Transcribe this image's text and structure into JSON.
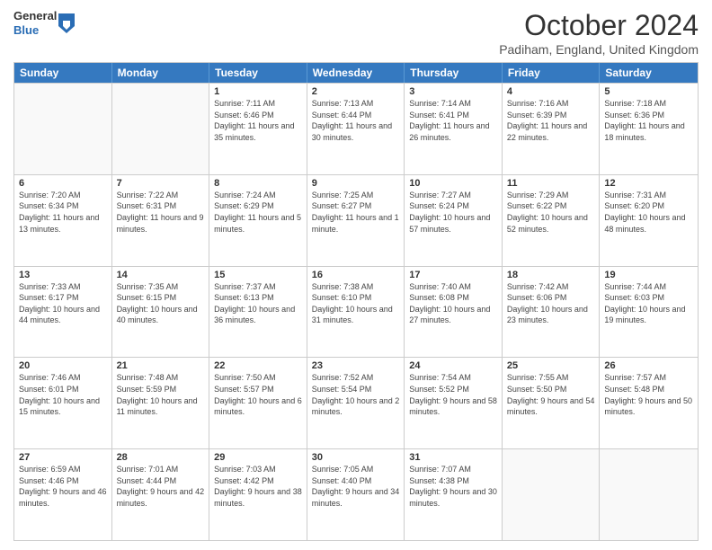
{
  "header": {
    "logo_general": "General",
    "logo_blue": "Blue",
    "month_title": "October 2024",
    "location": "Padiham, England, United Kingdom"
  },
  "day_headers": [
    "Sunday",
    "Monday",
    "Tuesday",
    "Wednesday",
    "Thursday",
    "Friday",
    "Saturday"
  ],
  "weeks": [
    [
      {
        "day": "",
        "sunrise": "",
        "sunset": "",
        "daylight": ""
      },
      {
        "day": "",
        "sunrise": "",
        "sunset": "",
        "daylight": ""
      },
      {
        "day": "1",
        "sunrise": "Sunrise: 7:11 AM",
        "sunset": "Sunset: 6:46 PM",
        "daylight": "Daylight: 11 hours and 35 minutes."
      },
      {
        "day": "2",
        "sunrise": "Sunrise: 7:13 AM",
        "sunset": "Sunset: 6:44 PM",
        "daylight": "Daylight: 11 hours and 30 minutes."
      },
      {
        "day": "3",
        "sunrise": "Sunrise: 7:14 AM",
        "sunset": "Sunset: 6:41 PM",
        "daylight": "Daylight: 11 hours and 26 minutes."
      },
      {
        "day": "4",
        "sunrise": "Sunrise: 7:16 AM",
        "sunset": "Sunset: 6:39 PM",
        "daylight": "Daylight: 11 hours and 22 minutes."
      },
      {
        "day": "5",
        "sunrise": "Sunrise: 7:18 AM",
        "sunset": "Sunset: 6:36 PM",
        "daylight": "Daylight: 11 hours and 18 minutes."
      }
    ],
    [
      {
        "day": "6",
        "sunrise": "Sunrise: 7:20 AM",
        "sunset": "Sunset: 6:34 PM",
        "daylight": "Daylight: 11 hours and 13 minutes."
      },
      {
        "day": "7",
        "sunrise": "Sunrise: 7:22 AM",
        "sunset": "Sunset: 6:31 PM",
        "daylight": "Daylight: 11 hours and 9 minutes."
      },
      {
        "day": "8",
        "sunrise": "Sunrise: 7:24 AM",
        "sunset": "Sunset: 6:29 PM",
        "daylight": "Daylight: 11 hours and 5 minutes."
      },
      {
        "day": "9",
        "sunrise": "Sunrise: 7:25 AM",
        "sunset": "Sunset: 6:27 PM",
        "daylight": "Daylight: 11 hours and 1 minute."
      },
      {
        "day": "10",
        "sunrise": "Sunrise: 7:27 AM",
        "sunset": "Sunset: 6:24 PM",
        "daylight": "Daylight: 10 hours and 57 minutes."
      },
      {
        "day": "11",
        "sunrise": "Sunrise: 7:29 AM",
        "sunset": "Sunset: 6:22 PM",
        "daylight": "Daylight: 10 hours and 52 minutes."
      },
      {
        "day": "12",
        "sunrise": "Sunrise: 7:31 AM",
        "sunset": "Sunset: 6:20 PM",
        "daylight": "Daylight: 10 hours and 48 minutes."
      }
    ],
    [
      {
        "day": "13",
        "sunrise": "Sunrise: 7:33 AM",
        "sunset": "Sunset: 6:17 PM",
        "daylight": "Daylight: 10 hours and 44 minutes."
      },
      {
        "day": "14",
        "sunrise": "Sunrise: 7:35 AM",
        "sunset": "Sunset: 6:15 PM",
        "daylight": "Daylight: 10 hours and 40 minutes."
      },
      {
        "day": "15",
        "sunrise": "Sunrise: 7:37 AM",
        "sunset": "Sunset: 6:13 PM",
        "daylight": "Daylight: 10 hours and 36 minutes."
      },
      {
        "day": "16",
        "sunrise": "Sunrise: 7:38 AM",
        "sunset": "Sunset: 6:10 PM",
        "daylight": "Daylight: 10 hours and 31 minutes."
      },
      {
        "day": "17",
        "sunrise": "Sunrise: 7:40 AM",
        "sunset": "Sunset: 6:08 PM",
        "daylight": "Daylight: 10 hours and 27 minutes."
      },
      {
        "day": "18",
        "sunrise": "Sunrise: 7:42 AM",
        "sunset": "Sunset: 6:06 PM",
        "daylight": "Daylight: 10 hours and 23 minutes."
      },
      {
        "day": "19",
        "sunrise": "Sunrise: 7:44 AM",
        "sunset": "Sunset: 6:03 PM",
        "daylight": "Daylight: 10 hours and 19 minutes."
      }
    ],
    [
      {
        "day": "20",
        "sunrise": "Sunrise: 7:46 AM",
        "sunset": "Sunset: 6:01 PM",
        "daylight": "Daylight: 10 hours and 15 minutes."
      },
      {
        "day": "21",
        "sunrise": "Sunrise: 7:48 AM",
        "sunset": "Sunset: 5:59 PM",
        "daylight": "Daylight: 10 hours and 11 minutes."
      },
      {
        "day": "22",
        "sunrise": "Sunrise: 7:50 AM",
        "sunset": "Sunset: 5:57 PM",
        "daylight": "Daylight: 10 hours and 6 minutes."
      },
      {
        "day": "23",
        "sunrise": "Sunrise: 7:52 AM",
        "sunset": "Sunset: 5:54 PM",
        "daylight": "Daylight: 10 hours and 2 minutes."
      },
      {
        "day": "24",
        "sunrise": "Sunrise: 7:54 AM",
        "sunset": "Sunset: 5:52 PM",
        "daylight": "Daylight: 9 hours and 58 minutes."
      },
      {
        "day": "25",
        "sunrise": "Sunrise: 7:55 AM",
        "sunset": "Sunset: 5:50 PM",
        "daylight": "Daylight: 9 hours and 54 minutes."
      },
      {
        "day": "26",
        "sunrise": "Sunrise: 7:57 AM",
        "sunset": "Sunset: 5:48 PM",
        "daylight": "Daylight: 9 hours and 50 minutes."
      }
    ],
    [
      {
        "day": "27",
        "sunrise": "Sunrise: 6:59 AM",
        "sunset": "Sunset: 4:46 PM",
        "daylight": "Daylight: 9 hours and 46 minutes."
      },
      {
        "day": "28",
        "sunrise": "Sunrise: 7:01 AM",
        "sunset": "Sunset: 4:44 PM",
        "daylight": "Daylight: 9 hours and 42 minutes."
      },
      {
        "day": "29",
        "sunrise": "Sunrise: 7:03 AM",
        "sunset": "Sunset: 4:42 PM",
        "daylight": "Daylight: 9 hours and 38 minutes."
      },
      {
        "day": "30",
        "sunrise": "Sunrise: 7:05 AM",
        "sunset": "Sunset: 4:40 PM",
        "daylight": "Daylight: 9 hours and 34 minutes."
      },
      {
        "day": "31",
        "sunrise": "Sunrise: 7:07 AM",
        "sunset": "Sunset: 4:38 PM",
        "daylight": "Daylight: 9 hours and 30 minutes."
      },
      {
        "day": "",
        "sunrise": "",
        "sunset": "",
        "daylight": ""
      },
      {
        "day": "",
        "sunrise": "",
        "sunset": "",
        "daylight": ""
      }
    ]
  ]
}
